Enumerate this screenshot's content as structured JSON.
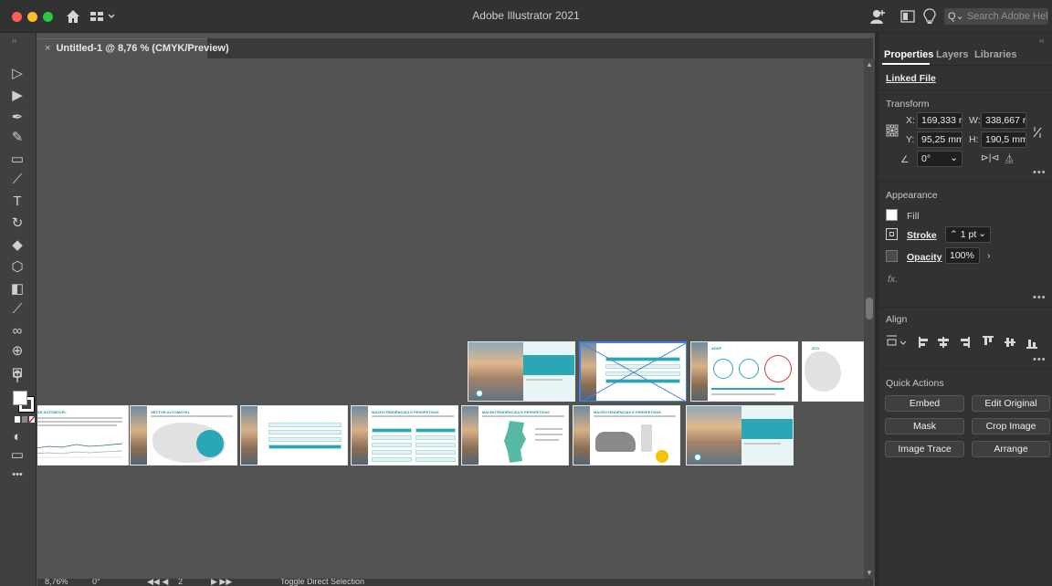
{
  "window": {
    "title": "Adobe Illustrator 2021",
    "search_placeholder": "Search Adobe Help"
  },
  "document": {
    "tab_label": "Untitled-1 @ 8,76 % (CMYK/Preview)",
    "close_glyph": "×"
  },
  "toolbar": {
    "tools": [
      {
        "name": "selection-tool",
        "glyph": "▷"
      },
      {
        "name": "direct-selection-tool",
        "glyph": "▶"
      },
      {
        "name": "pen-tool",
        "glyph": "✒"
      },
      {
        "name": "curvature-tool",
        "glyph": "✎"
      },
      {
        "name": "rectangle-tool",
        "glyph": "▭"
      },
      {
        "name": "paintbrush-tool",
        "glyph": "⟋"
      },
      {
        "name": "type-tool",
        "glyph": "T"
      },
      {
        "name": "rotate-tool",
        "glyph": "↻"
      },
      {
        "name": "eraser-tool",
        "glyph": "◆"
      },
      {
        "name": "shape-builder-tool",
        "glyph": "⬡"
      },
      {
        "name": "gradient-tool",
        "glyph": "◧"
      },
      {
        "name": "eyedropper-tool",
        "glyph": "⟋"
      },
      {
        "name": "blend-tool",
        "glyph": "∞"
      },
      {
        "name": "symbol-sprayer-tool",
        "glyph": "⊕"
      },
      {
        "name": "artboard-tool",
        "glyph": "⊞"
      },
      {
        "name": "hand-tool",
        "glyph": "✋"
      },
      {
        "name": "zoom-tool",
        "glyph": "⚲"
      }
    ],
    "more_glyph": "•••"
  },
  "status_bar": {
    "zoom": "8,76%",
    "rotation": "0°",
    "artboard_number": "2",
    "active_tool": "Toggle Direct Selection"
  },
  "panel": {
    "tabs": [
      {
        "label": "Properties",
        "active": true
      },
      {
        "label": "Layers",
        "active": false
      },
      {
        "label": "Libraries",
        "active": false
      }
    ],
    "linked_file": "Linked File",
    "transform": {
      "heading": "Transform",
      "x_label": "X:",
      "x_value": "169,333 r",
      "w_label": "W:",
      "w_value": "338,667 r",
      "y_label": "Y:",
      "y_value": "95,25 mm",
      "h_label": "H:",
      "h_value": "190,5 mm",
      "angle_value": "0°"
    },
    "appearance": {
      "heading": "Appearance",
      "fill_label": "Fill",
      "stroke_label": "Stroke",
      "stroke_value": "1 pt",
      "opacity_label": "Opacity",
      "opacity_value": "100%",
      "fx_label": "fx."
    },
    "align": {
      "heading": "Align"
    },
    "quick_actions": {
      "heading": "Quick Actions",
      "buttons": [
        "Embed",
        "Edit Original",
        "Mask",
        "Crop Image",
        "Image Trace",
        "Arrange"
      ]
    },
    "more_glyph": "•••"
  },
  "colors": {
    "accent_teal": "#2aa7b4",
    "selection_blue": "#4a7fd6",
    "canvas_bg": "#535353"
  }
}
